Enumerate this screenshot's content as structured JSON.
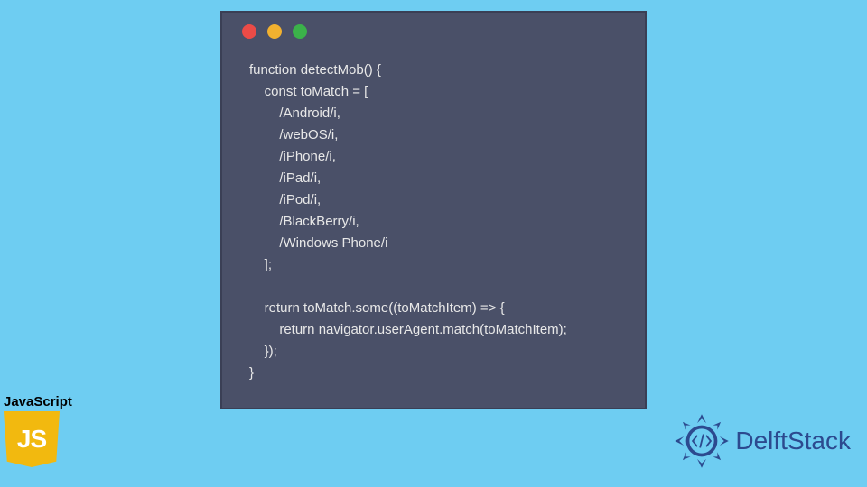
{
  "code": {
    "lines": [
      "function detectMob() {",
      "    const toMatch = [",
      "        /Android/i,",
      "        /webOS/i,",
      "        /iPhone/i,",
      "        /iPad/i,",
      "        /iPod/i,",
      "        /BlackBerry/i,",
      "        /Windows Phone/i",
      "    ];",
      "",
      "    return toMatch.some((toMatchItem) => {",
      "        return navigator.userAgent.match(toMatchItem);",
      "    });",
      "}"
    ]
  },
  "window": {
    "dots": [
      "red",
      "yellow",
      "green"
    ]
  },
  "jsBadge": {
    "label": "JavaScript",
    "logoText": "JS"
  },
  "brand": {
    "name": "DelftStack"
  },
  "colors": {
    "pageBg": "#6ecdf2",
    "windowBg": "#4a5068",
    "codeText": "#e8e8e8",
    "brand": "#2c4a8f",
    "jsLogo": "#f2b90f"
  }
}
